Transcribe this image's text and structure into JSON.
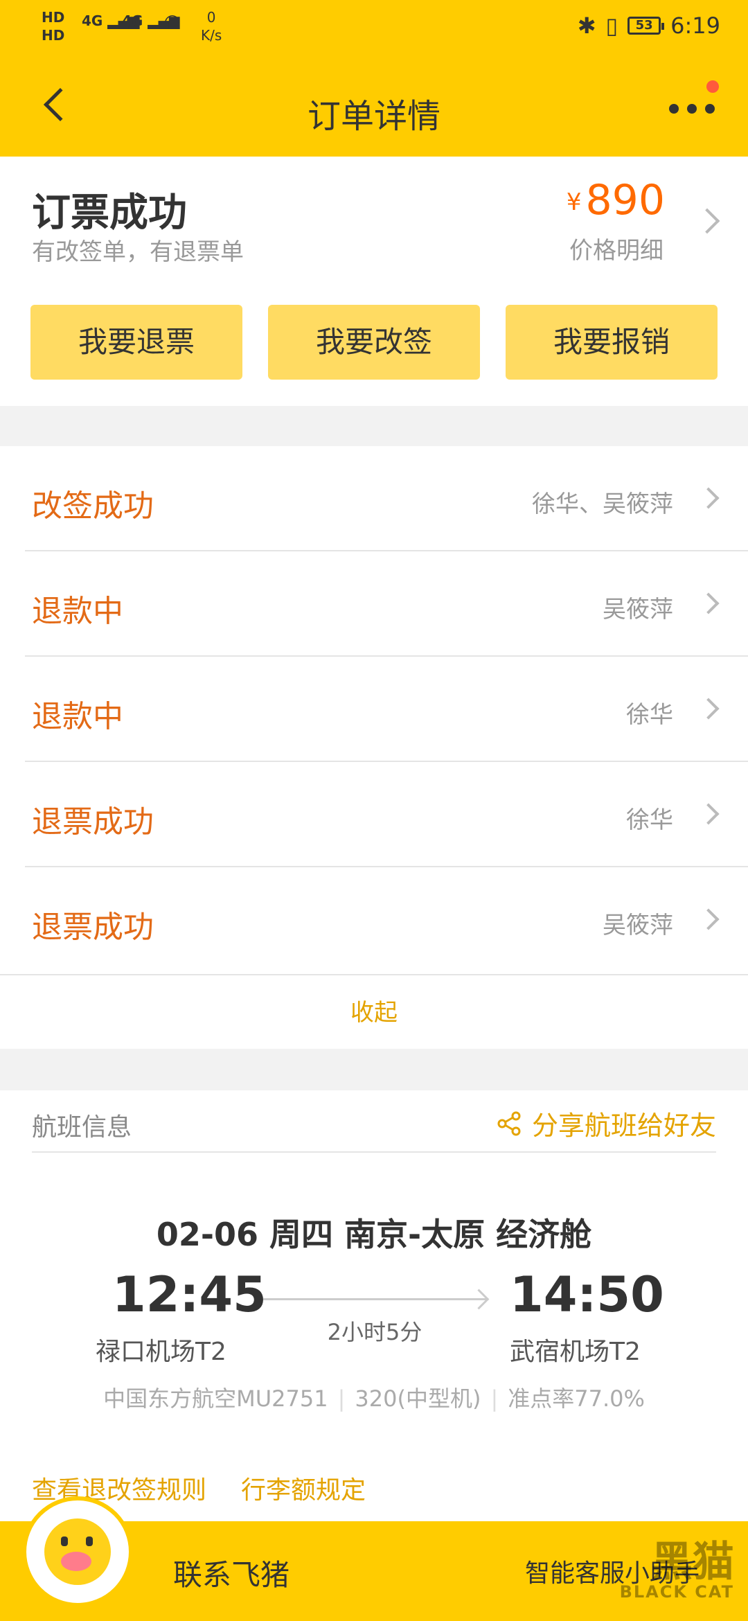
{
  "status_bar": {
    "hd1": "HD",
    "hd2": "HD",
    "signal1": "4G",
    "signal2": "4G",
    "net_speed": "0",
    "net_unit": "K/s",
    "battery": "53",
    "time": "6:19"
  },
  "header": {
    "title": "订单详情"
  },
  "summary": {
    "status": "订票成功",
    "sub": "有改签单，有退票单",
    "currency": "¥",
    "price": "890",
    "price_detail": "价格明细",
    "actions": [
      "我要退票",
      "我要改签",
      "我要报销"
    ]
  },
  "records": [
    {
      "status": "改签成功",
      "people": "徐华、吴筱萍"
    },
    {
      "status": "退款中",
      "people": "吴筱萍"
    },
    {
      "status": "退款中",
      "people": "徐华"
    },
    {
      "status": "退票成功",
      "people": "徐华"
    },
    {
      "status": "退票成功",
      "people": "吴筱萍"
    }
  ],
  "collapse_label": "收起",
  "flight": {
    "section_label": "航班信息",
    "share_label": "分享航班给好友",
    "route": "02-06  周四  南京-太原  经济舱",
    "dep_time": "12:45",
    "dep_airport": "禄口机场T2",
    "arr_time": "14:50",
    "arr_airport": "武宿机场T2",
    "duration": "2小时5分",
    "airline": "中国东方航空MU2751",
    "aircraft": "320(中型机)",
    "on_time": "准点率77.0%"
  },
  "links": {
    "rules": "查看退改签规则",
    "baggage": "行李额规定"
  },
  "bottom": {
    "contact": "联系飞猪",
    "assistant": "智能客服小助手",
    "watermark_cn": "黑猫",
    "watermark_en": "BLACK CAT"
  },
  "colors": {
    "brand_yellow": "#ffcc00",
    "button_yellow": "#ffdb62",
    "status_orange": "#e36a16",
    "price_orange": "#ff6a00",
    "link_gold": "#e4a300"
  }
}
